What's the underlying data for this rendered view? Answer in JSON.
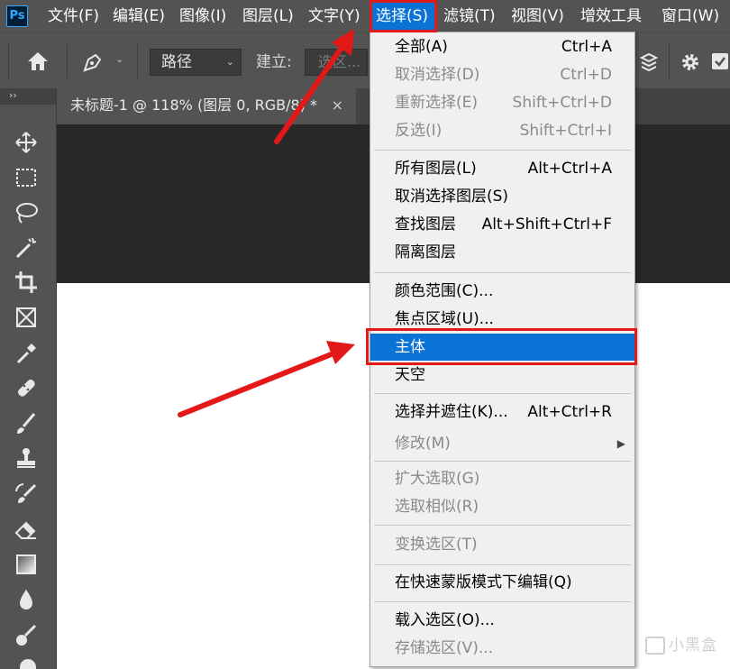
{
  "menubar": {
    "logo": "Ps",
    "items": [
      "文件(F)",
      "编辑(E)",
      "图像(I)",
      "图层(L)",
      "文字(Y)",
      "选择(S)",
      "滤镜(T)",
      "视图(V)",
      "增效工具",
      "窗口(W)"
    ],
    "active_index": 5
  },
  "options_bar": {
    "mode_select": "路径",
    "build_label": "建立:",
    "selection_button": "选区..."
  },
  "toolbar": {
    "collapse": "››",
    "tools": [
      "move-tool",
      "marquee-tool",
      "lasso-tool",
      "magic-wand-tool",
      "crop-tool",
      "frame-tool",
      "eyedropper-tool",
      "healing-brush-tool",
      "brush-tool",
      "clone-stamp-tool",
      "history-brush-tool",
      "eraser-tool",
      "gradient-tool",
      "blur-tool",
      "dodge-tool"
    ]
  },
  "document": {
    "tab_title": "未标题-1 @ 118% (图层 0, RGB/8) *",
    "close": "×"
  },
  "select_menu": {
    "groups": [
      [
        {
          "label": "全部(A)",
          "shortcut": "Ctrl+A",
          "enabled": true
        },
        {
          "label": "取消选择(D)",
          "shortcut": "Ctrl+D",
          "enabled": false
        },
        {
          "label": "重新选择(E)",
          "shortcut": "Shift+Ctrl+D",
          "enabled": false
        },
        {
          "label": "反选(I)",
          "shortcut": "Shift+Ctrl+I",
          "enabled": false
        }
      ],
      [
        {
          "label": "所有图层(L)",
          "shortcut": "Alt+Ctrl+A",
          "enabled": true
        },
        {
          "label": "取消选择图层(S)",
          "shortcut": "",
          "enabled": true
        },
        {
          "label": "查找图层",
          "shortcut": "Alt+Shift+Ctrl+F",
          "enabled": true
        },
        {
          "label": "隔离图层",
          "shortcut": "",
          "enabled": true
        }
      ],
      [
        {
          "label": "颜色范围(C)...",
          "shortcut": "",
          "enabled": true
        },
        {
          "label": "焦点区域(U)...",
          "shortcut": "",
          "enabled": true
        },
        {
          "label": "主体",
          "shortcut": "",
          "enabled": true,
          "highlighted": true
        },
        {
          "label": "天空",
          "shortcut": "",
          "enabled": true
        }
      ],
      [
        {
          "label": "选择并遮住(K)...",
          "shortcut": "Alt+Ctrl+R",
          "enabled": true
        },
        {
          "label": "修改(M)",
          "shortcut": "",
          "enabled": false,
          "submenu": true
        }
      ],
      [
        {
          "label": "扩大选取(G)",
          "shortcut": "",
          "enabled": false
        },
        {
          "label": "选取相似(R)",
          "shortcut": "",
          "enabled": false
        }
      ],
      [
        {
          "label": "变换选区(T)",
          "shortcut": "",
          "enabled": false
        }
      ],
      [
        {
          "label": "在快速蒙版模式下编辑(Q)",
          "shortcut": "",
          "enabled": true
        }
      ],
      [
        {
          "label": "载入选区(O)...",
          "shortcut": "",
          "enabled": true
        },
        {
          "label": "存储选区(V)...",
          "shortcut": "",
          "enabled": false
        }
      ]
    ],
    "submenu_arrow": "▶"
  },
  "watermark": "小黑盒",
  "colors": {
    "menubar_bg": "#535353",
    "highlight": "#0b72d6",
    "annotation_red": "#e31818",
    "pasteboard": "#282828",
    "canvas": "#ffffff"
  }
}
